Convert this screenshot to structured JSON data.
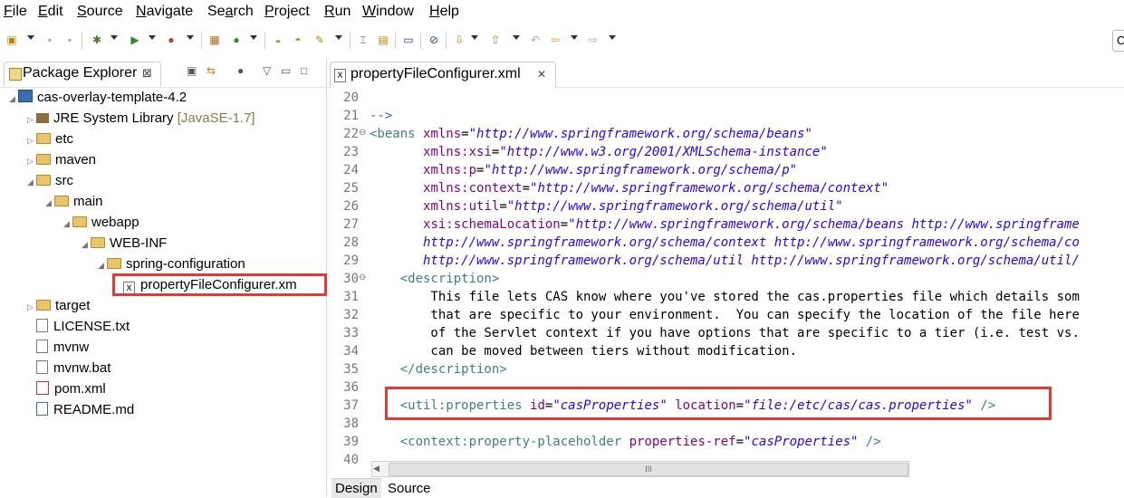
{
  "menubar": {
    "items": [
      {
        "label": "File",
        "u": "F",
        "rest": "ile"
      },
      {
        "label": "Edit",
        "u": "E",
        "rest": "dit"
      },
      {
        "label": "Source",
        "u": "S",
        "rest": "ource"
      },
      {
        "label": "Navigate",
        "u": "N",
        "rest": "avigate"
      },
      {
        "label": "Search",
        "u": "a",
        "pre": "Se",
        "rest": "rch"
      },
      {
        "label": "Project",
        "u": "P",
        "rest": "roject"
      },
      {
        "label": "Run",
        "u": "R",
        "rest": "un"
      },
      {
        "label": "Window",
        "u": "W",
        "rest": "indow"
      },
      {
        "label": "Help",
        "u": "H",
        "rest": "elp"
      }
    ]
  },
  "toolbar": {
    "search_glyph": "C"
  },
  "package_explorer": {
    "title": "Package Explorer",
    "close_glyph": "⊠",
    "tree": [
      {
        "label": "cas-overlay-template-4.2",
        "decor": "",
        "icon": "project-icon",
        "twisty": "◢"
      },
      {
        "label": "JRE System Library",
        "decor": "[JavaSE-1.7]",
        "icon": "library-icon",
        "twisty": "▷"
      },
      {
        "label": "etc",
        "decor": "",
        "icon": "folder-icon",
        "twisty": "▷"
      },
      {
        "label": "maven",
        "decor": "",
        "icon": "folder-icon",
        "twisty": "▷"
      },
      {
        "label": "src",
        "decor": "",
        "icon": "folder-icon",
        "twisty": "◢"
      },
      {
        "label": "main",
        "decor": "",
        "icon": "folder-icon",
        "twisty": "◢"
      },
      {
        "label": "webapp",
        "decor": "",
        "icon": "folder-icon",
        "twisty": "◢"
      },
      {
        "label": "WEB-INF",
        "decor": "",
        "icon": "folder-icon",
        "twisty": "◢"
      },
      {
        "label": "spring-configuration",
        "decor": "",
        "icon": "folder-icon",
        "twisty": "◢"
      },
      {
        "label": "propertyFileConfigurer.xm",
        "decor": "",
        "icon": "xml-file-icon",
        "twisty": ""
      },
      {
        "label": "target",
        "decor": "",
        "icon": "folder-icon",
        "twisty": "▷"
      },
      {
        "label": "LICENSE.txt",
        "decor": "",
        "icon": "file-icon",
        "twisty": ""
      },
      {
        "label": "mvnw",
        "decor": "",
        "icon": "file-icon",
        "twisty": ""
      },
      {
        "label": "mvnw.bat",
        "decor": "",
        "icon": "file-icon",
        "twisty": ""
      },
      {
        "label": "pom.xml",
        "decor": "",
        "icon": "maven-pom-icon",
        "twisty": ""
      },
      {
        "label": "README.md",
        "decor": "",
        "icon": "markdown-file-icon",
        "twisty": ""
      }
    ]
  },
  "editor": {
    "tab_title": "propertyFileConfigurer.xml",
    "tab_close": "✕",
    "xml_badge": "X",
    "lines": [
      {
        "no": "20",
        "fold": "",
        "parts": []
      },
      {
        "no": "21",
        "fold": "",
        "parts": [
          {
            "c": "cmt",
            "t": "-->"
          }
        ]
      },
      {
        "no": "22",
        "fold": "⊖",
        "parts": [
          {
            "c": "tag",
            "t": "<beans "
          },
          {
            "c": "attr",
            "t": "xmlns"
          },
          {
            "c": "txt",
            "t": "="
          },
          {
            "c": "val",
            "t": "\"http://www.springframework.org/schema/beans\""
          }
        ]
      },
      {
        "no": "23",
        "fold": "",
        "parts": [
          {
            "c": "txt",
            "t": "       "
          },
          {
            "c": "attr",
            "t": "xmlns:xsi"
          },
          {
            "c": "txt",
            "t": "="
          },
          {
            "c": "val",
            "t": "\"http://www.w3.org/2001/XMLSchema-instance\""
          }
        ]
      },
      {
        "no": "24",
        "fold": "",
        "parts": [
          {
            "c": "txt",
            "t": "       "
          },
          {
            "c": "attr",
            "t": "xmlns:p"
          },
          {
            "c": "txt",
            "t": "="
          },
          {
            "c": "val",
            "t": "\"http://www.springframework.org/schema/p\""
          }
        ]
      },
      {
        "no": "25",
        "fold": "",
        "parts": [
          {
            "c": "txt",
            "t": "       "
          },
          {
            "c": "attr",
            "t": "xmlns:context"
          },
          {
            "c": "txt",
            "t": "="
          },
          {
            "c": "val",
            "t": "\"http://www.springframework.org/schema/context\""
          }
        ]
      },
      {
        "no": "26",
        "fold": "",
        "parts": [
          {
            "c": "txt",
            "t": "       "
          },
          {
            "c": "attr",
            "t": "xmlns:util"
          },
          {
            "c": "txt",
            "t": "="
          },
          {
            "c": "val",
            "t": "\"http://www.springframework.org/schema/util\""
          }
        ]
      },
      {
        "no": "27",
        "fold": "",
        "parts": [
          {
            "c": "txt",
            "t": "       "
          },
          {
            "c": "attr",
            "t": "xsi:schemaLocation"
          },
          {
            "c": "txt",
            "t": "="
          },
          {
            "c": "val",
            "t": "\"http://www.springframework.org/schema/beans http://www.springframe"
          }
        ]
      },
      {
        "no": "28",
        "fold": "",
        "parts": [
          {
            "c": "val",
            "t": "       http://www.springframework.org/schema/context http://www.springframework.org/schema/co"
          }
        ]
      },
      {
        "no": "29",
        "fold": "",
        "parts": [
          {
            "c": "val",
            "t": "       http://www.springframework.org/schema/util http://www.springframework.org/schema/util/"
          }
        ]
      },
      {
        "no": "30",
        "fold": "⊖",
        "parts": [
          {
            "c": "txt",
            "t": "    "
          },
          {
            "c": "tag",
            "t": "<description>"
          }
        ]
      },
      {
        "no": "31",
        "fold": "",
        "parts": [
          {
            "c": "txt",
            "t": "        This file lets CAS know where you've stored the cas.properties file which details som"
          }
        ]
      },
      {
        "no": "32",
        "fold": "",
        "parts": [
          {
            "c": "txt",
            "t": "        that are specific to your environment.  You can specify the location of the file here"
          }
        ]
      },
      {
        "no": "33",
        "fold": "",
        "parts": [
          {
            "c": "txt",
            "t": "        of the Servlet context if you have options that are specific to a tier (i.e. test vs."
          }
        ]
      },
      {
        "no": "34",
        "fold": "",
        "parts": [
          {
            "c": "txt",
            "t": "        can be moved between tiers without modification."
          }
        ]
      },
      {
        "no": "35",
        "fold": "",
        "parts": [
          {
            "c": "txt",
            "t": "    "
          },
          {
            "c": "tag",
            "t": "</description>"
          }
        ]
      },
      {
        "no": "36",
        "fold": "",
        "parts": []
      },
      {
        "no": "37",
        "fold": "",
        "parts": [
          {
            "c": "txt",
            "t": "    "
          },
          {
            "c": "tag",
            "t": "<util:properties "
          },
          {
            "c": "attr",
            "t": "id"
          },
          {
            "c": "txt",
            "t": "="
          },
          {
            "c": "val",
            "t": "\"casProperties\""
          },
          {
            "c": "txt",
            "t": " "
          },
          {
            "c": "attr",
            "t": "location"
          },
          {
            "c": "txt",
            "t": "="
          },
          {
            "c": "val",
            "t": "\"file:/etc/cas/cas.properties\""
          },
          {
            "c": "txt",
            "t": " "
          },
          {
            "c": "tag",
            "t": "/>"
          }
        ]
      },
      {
        "no": "38",
        "fold": "",
        "parts": []
      },
      {
        "no": "39",
        "fold": "",
        "parts": [
          {
            "c": "txt",
            "t": "    "
          },
          {
            "c": "tag",
            "t": "<context:property-placeholder "
          },
          {
            "c": "attr",
            "t": "properties-ref"
          },
          {
            "c": "txt",
            "t": "="
          },
          {
            "c": "val",
            "t": "\"casProperties\""
          },
          {
            "c": "txt",
            "t": " "
          },
          {
            "c": "tag",
            "t": "/>"
          }
        ]
      },
      {
        "no": "40",
        "fold": "",
        "parts": []
      }
    ],
    "scroll_thumb_glyph": "III",
    "scroll_left_glyph": "◀",
    "bottom_tabs": [
      {
        "label": "Design",
        "active": false
      },
      {
        "label": "Source",
        "active": true
      }
    ]
  }
}
